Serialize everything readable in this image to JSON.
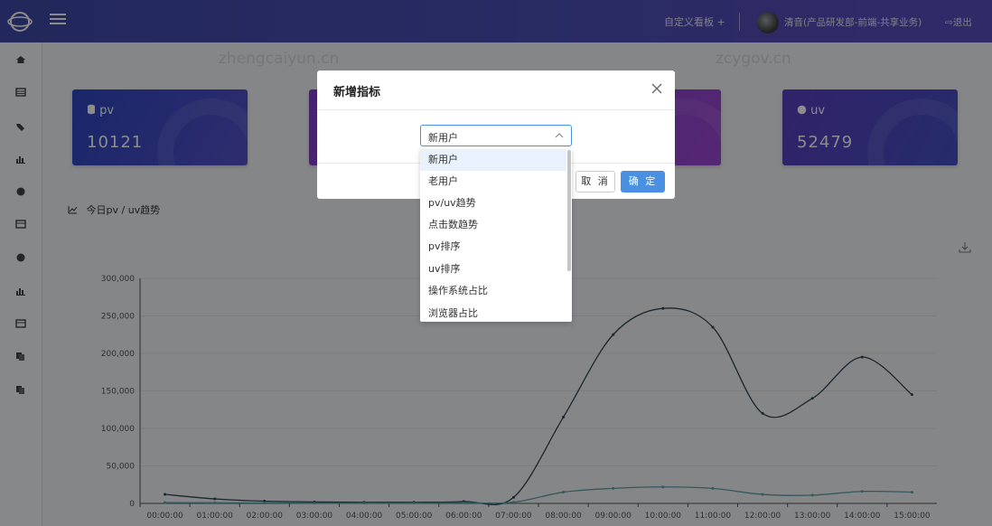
{
  "topbar": {
    "custom_board": "自定义看板 +",
    "user_name": "清音(产品研发部-前端-共享业务)",
    "logout": "⇨退出"
  },
  "watermarks": [
    "zhengcaiyun.cn",
    "zcygov.cn"
  ],
  "cards": [
    {
      "label": "pv",
      "value": "10121",
      "icon": "database-icon"
    },
    {
      "label": "uv",
      "value": "52479",
      "icon": "globe-icon"
    }
  ],
  "chart": {
    "title": "今日pv / uv趋势"
  },
  "chart_data": {
    "type": "line",
    "x": [
      "00:00:00",
      "01:00:00",
      "02:00:00",
      "03:00:00",
      "04:00:00",
      "05:00:00",
      "06:00:00",
      "07:00:00",
      "08:00:00",
      "09:00:00",
      "10:00:00",
      "11:00:00",
      "12:00:00",
      "13:00:00",
      "14:00:00",
      "15:00:00"
    ],
    "y_ticks": [
      "0",
      "50,000",
      "100,000",
      "150,000",
      "200,000",
      "250,000",
      "300,000"
    ],
    "ylim": [
      0,
      300000
    ],
    "series": [
      {
        "color": "#2f4554",
        "values": [
          12000,
          6000,
          3000,
          2000,
          1500,
          1500,
          2500,
          8000,
          115000,
          225000,
          260000,
          235000,
          120000,
          140000,
          195000,
          145000
        ]
      },
      {
        "color": "#61a0a8",
        "values": [
          1000,
          800,
          600,
          500,
          500,
          500,
          800,
          1500,
          15000,
          20000,
          22000,
          20000,
          12000,
          11000,
          16000,
          15000
        ]
      }
    ]
  },
  "modal": {
    "title": "新增指标",
    "selected": "新用户",
    "cancel": "取 消",
    "ok": "确 定"
  },
  "dropdown": {
    "items": [
      "新用户",
      "老用户",
      "pv/uv趋势",
      "点击数趋势",
      "pv排序",
      "uv排序",
      "操作系统占比",
      "浏览器占比"
    ]
  }
}
